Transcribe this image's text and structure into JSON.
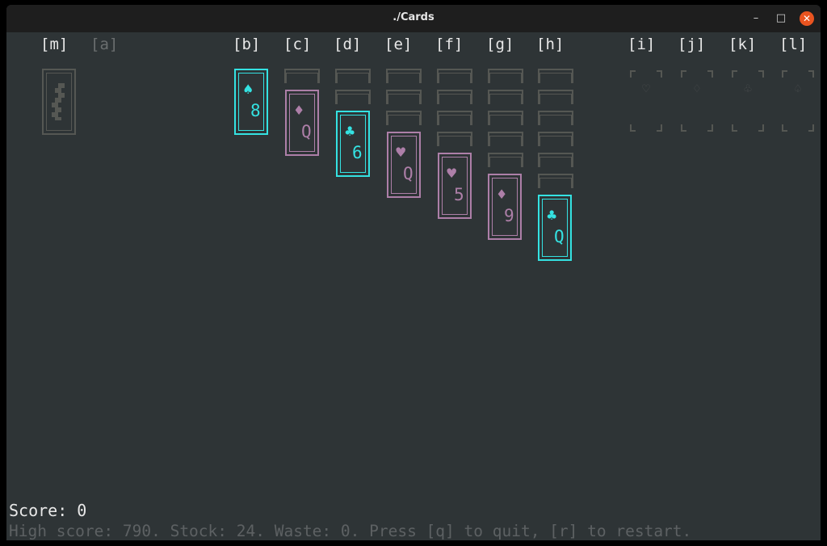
{
  "window": {
    "title": "./Cards",
    "minimize_glyph": "–",
    "maximize_glyph": "□",
    "close_glyph": "✕",
    "close_color": "#e95420"
  },
  "colors": {
    "background": "#2e3436",
    "cyan": "#34e2e2",
    "pink": "#ad7fa8",
    "inactive": "#555753"
  },
  "labels": {
    "m": "[m]",
    "a": "[a]",
    "b": "[b]",
    "c": "[c]",
    "d": "[d]",
    "e": "[e]",
    "f": "[f]",
    "g": "[g]",
    "h": "[h]",
    "i": "[i]",
    "j": "[j]",
    "k": "[k]",
    "l": "[l]"
  },
  "stock": {
    "icon": "card-back-pattern"
  },
  "tableau": {
    "b": {
      "suit": "♠",
      "rank": "8",
      "color": "cyan"
    },
    "c": {
      "suit": "♦",
      "rank": "Q",
      "color": "pink"
    },
    "d": {
      "suit": "♣",
      "rank": "6",
      "color": "cyan"
    },
    "e": {
      "suit": "♥",
      "rank": "Q",
      "color": "pink"
    },
    "f": {
      "suit": "♥",
      "rank": "5",
      "color": "pink"
    },
    "g": {
      "suit": "♦",
      "rank": "9",
      "color": "pink"
    },
    "h": {
      "suit": "♣",
      "rank": "Q",
      "color": "cyan"
    }
  },
  "foundations": {
    "i": {
      "suit": "♡"
    },
    "j": {
      "suit": "♢"
    },
    "k": {
      "suit": "♧"
    },
    "l": {
      "suit": "♤"
    }
  },
  "footer": {
    "score": "Score: 0",
    "status": "High score: 790. Stock: 24. Waste: 0. Press [q] to quit, [r] to restart."
  }
}
